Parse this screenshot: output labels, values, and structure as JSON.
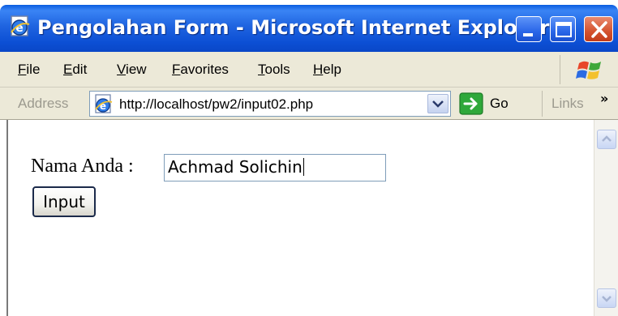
{
  "window": {
    "title": "Pengolahan Form - Microsoft Internet Explorer"
  },
  "menu": {
    "file": "File",
    "edit": "Edit",
    "view": "View",
    "favorites": "Favorites",
    "tools": "Tools",
    "help": "Help"
  },
  "address_bar": {
    "label": "Address",
    "url": "http://localhost/pw2/input02.php",
    "go_label": "Go",
    "links_label": "Links",
    "links_more": "»"
  },
  "form": {
    "label": "Nama Anda :",
    "input_value": "Achmad Solichin",
    "submit_label": "Input"
  },
  "icons": {
    "title": "ie-page-icon",
    "windows": "windows-logo-icon",
    "address": "ie-page-icon",
    "go": "go-arrow-icon",
    "dropdown": "chevron-down-icon"
  },
  "colors": {
    "titlebar_blue": "#0c4fd4",
    "chrome": "#ece9d8",
    "close_red": "#d4522e",
    "go_green": "#2fa83a"
  }
}
